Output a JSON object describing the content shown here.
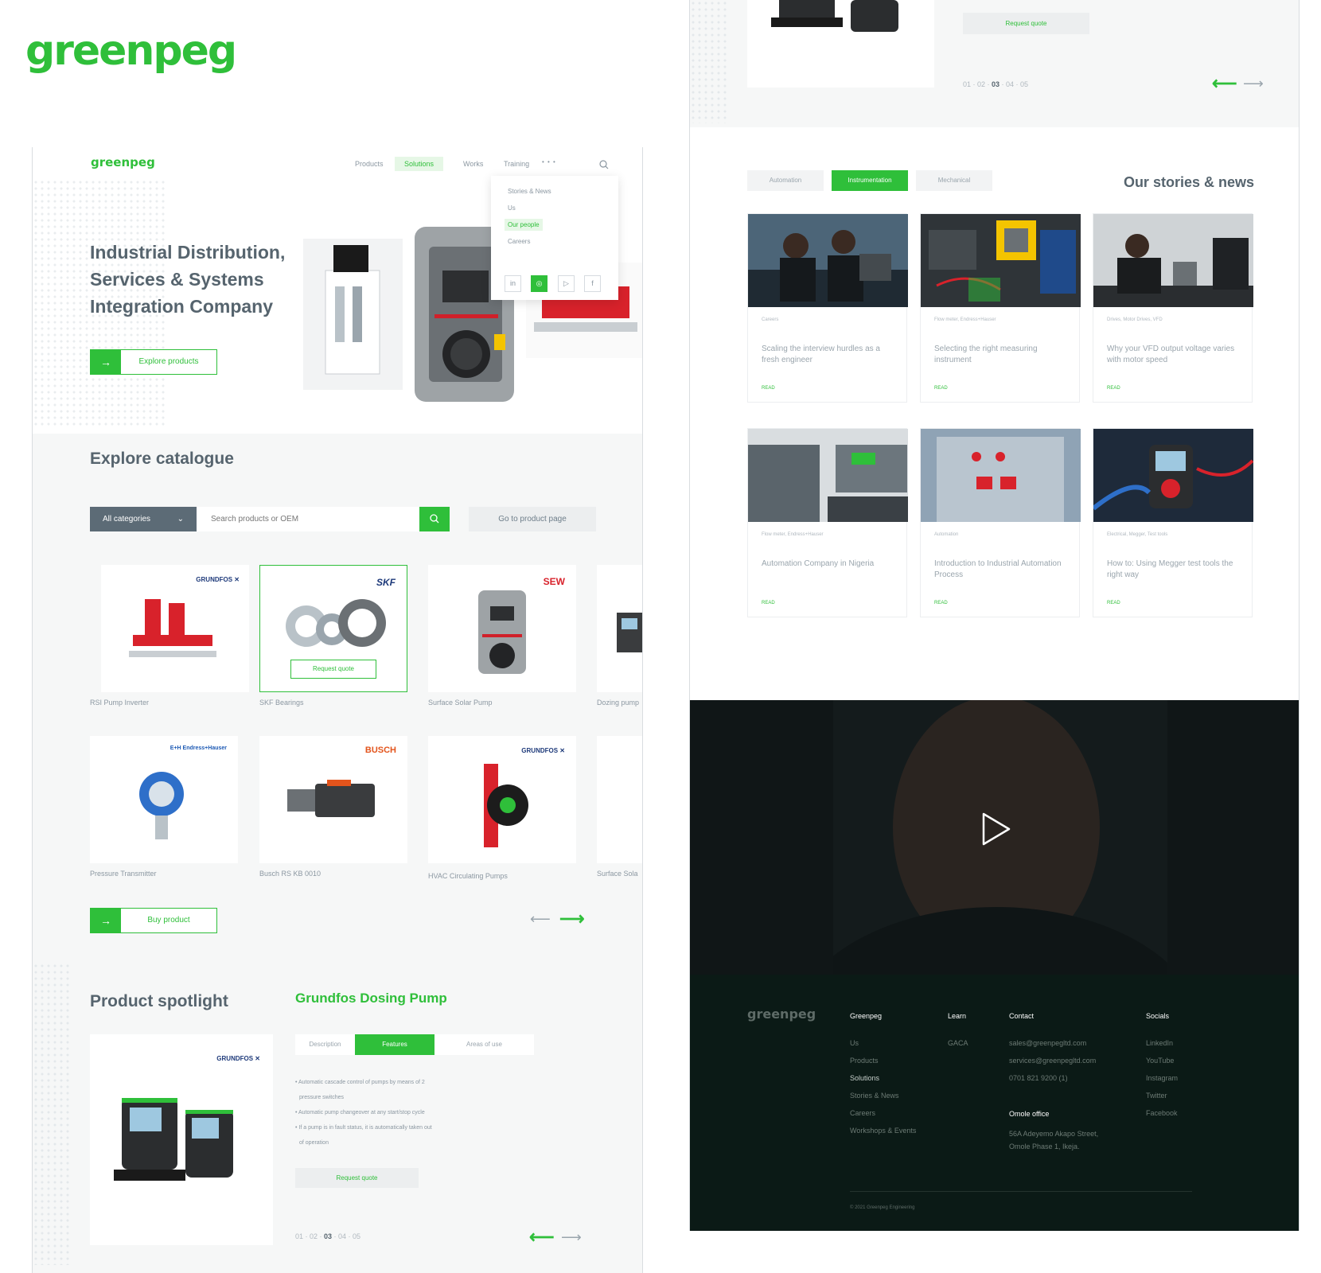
{
  "brand": {
    "logo": "greenpeg",
    "accent": "#2fbf3a",
    "dark": "#56646e"
  },
  "nav": {
    "logo": "greenpeg",
    "items": [
      "Products",
      "Solutions",
      "Works",
      "Training"
    ],
    "active": "Solutions",
    "more": "• • •",
    "dropdown": [
      "Stories & News",
      "Us",
      "Our people",
      "Careers"
    ],
    "dropdown_active": "Our people",
    "socials": [
      "in",
      "◎",
      "▷",
      "f"
    ]
  },
  "hero": {
    "title": "Industrial Distribution, Services & Systems Integration Company",
    "button": "Explore products"
  },
  "catalogue": {
    "title": "Explore catalogue",
    "category": "All categories",
    "search_placeholder": "Search products or OEM",
    "go_button": "Go to product page",
    "request_quote": "Request quote",
    "products": [
      {
        "name": "RSI Pump Inverter",
        "brand": "GRUNDFOS ✕"
      },
      {
        "name": "SKF Bearings",
        "brand": "SKF"
      },
      {
        "name": "Surface Solar Pump",
        "brand": "SEW"
      },
      {
        "name": "Dozing pump",
        "brand": ""
      },
      {
        "name": "Pressure Transmitter",
        "brand": "E+H Endress+Hauser"
      },
      {
        "name": "Busch RS KB 0010",
        "brand": "BUSCH"
      },
      {
        "name": "HVAC Circulating Pumps",
        "brand": "GRUNDFOS ✕"
      },
      {
        "name": "Surface Sola",
        "brand": ""
      }
    ],
    "buy_button": "Buy product"
  },
  "spotlight": {
    "title": "Product spotlight",
    "product": "Grundfos Dosing Pump",
    "brand": "GRUNDFOS ✕",
    "tabs": [
      "Description",
      "Features",
      "Areas of use"
    ],
    "active_tab": "Features",
    "features": [
      "• Automatic cascade control of pumps by means of 2",
      "pressure switches",
      "• Automatic pump changeover at any start/stop cycle",
      "• If a pump is in fault status, it is automatically taken out",
      "of operation"
    ],
    "request_quote": "Request quote",
    "pager": {
      "pre": "01 · 02 · ",
      "current": "03",
      "post": " · 04 · 05"
    }
  },
  "right_top": {
    "request_quote": "Request quote",
    "pager": {
      "pre": "01 · 02 · ",
      "current": "03",
      "post": " · 04 · 05"
    }
  },
  "stories": {
    "title": "Our stories & news",
    "tabs": [
      "Automation",
      "Instrumentation",
      "Mechanical"
    ],
    "active_tab": "Instrumentation",
    "read": "READ",
    "items": [
      {
        "tag": "Careers",
        "title": "Scaling the interview hurdles as a fresh engineer"
      },
      {
        "tag": "Flow meter, Endress+Hauser",
        "title": "Selecting the right measuring instrument"
      },
      {
        "tag": "Drives, Motor Drives, VFD",
        "title": "Why your VFD output voltage varies with motor speed"
      },
      {
        "tag": "Flow meter, Endress+Hauser",
        "title": "Automation Company in Nigeria"
      },
      {
        "tag": "Automation",
        "title": "Introduction to Industrial Automation Process"
      },
      {
        "tag": "Electrical, Megger, Test tools",
        "title": "How to: Using Megger test tools the right way"
      }
    ]
  },
  "footer": {
    "logo": "greenpeg",
    "cols": {
      "greenpeg": {
        "title": "Greenpeg",
        "links": [
          "Us",
          "Products",
          "Solutions",
          "Stories & News",
          "Careers",
          "Workshops & Events"
        ]
      },
      "learn": {
        "title": "Learn",
        "links": [
          "GACA"
        ]
      },
      "contact": {
        "title": "Contact",
        "links": [
          "sales@greenpegltd.com",
          "services@greenpegltd.com",
          "0701  821  9200 (1)"
        ]
      },
      "office": {
        "title": "Omole office",
        "lines": [
          "56A Adeyemo Akapo Street,",
          "Omole Phase 1, Ikeja."
        ]
      },
      "socials": {
        "title": "Socials",
        "links": [
          "LinkedIn",
          "YouTube",
          "Instagram",
          "Twitter",
          "Facebook"
        ]
      }
    },
    "copyright": "© 2021 Greenpeg Engineering"
  }
}
